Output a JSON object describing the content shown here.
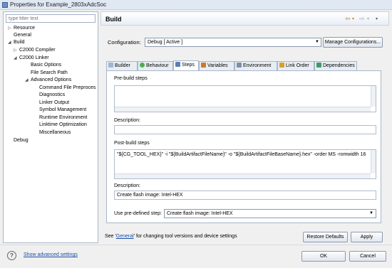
{
  "window": {
    "title": "Properties for Example_2803xAdcSoc"
  },
  "filter": {
    "placeholder": "type filter text"
  },
  "tree": {
    "resource": "Resource",
    "general": "General",
    "build": "Build",
    "compiler": "C2000 Compiler",
    "linker": "C2000 Linker",
    "basic_options": "Basic Options",
    "file_search_path": "File Search Path",
    "advanced_options": "Advanced Options",
    "cmd_file_preproc": "Command File Preproces",
    "diagnostics": "Diagnostics",
    "linker_output": "Linker Output",
    "symbol_mgmt": "Symbol Management",
    "runtime_env": "Runtime Environment",
    "linktime_opt": "Linktime Optimization",
    "misc": "Miscellaneous",
    "debug": "Debug"
  },
  "header": {
    "title": "Build",
    "back": "⇦",
    "forward": "⇨",
    "menu": "▾"
  },
  "config": {
    "label": "Configuration:",
    "value": "Debug  [ Active ]",
    "manage_button": "Manage Configurations..."
  },
  "tabs": [
    "Builder",
    "Behaviour",
    "Steps",
    "Variables",
    "Environment",
    "Link Order",
    "Dependencies"
  ],
  "steps": {
    "pre_label": "Pre-build steps",
    "pre_value": "",
    "pre_desc_label": "Description:",
    "pre_desc_value": "",
    "post_label": "Post-build steps",
    "post_value": "\"${CG_TOOL_HEX}\" -i \"${BuildArtifactFileName}\" -o \"${BuildArtifactFileBaseName}.hex\" -order MS -romwidth 16",
    "post_desc_label": "Description:",
    "post_desc_value": "Create flash image: Intel-HEX",
    "predef_label": "Use pre-defined step:",
    "predef_value": "Create flash image: Intel-HEX"
  },
  "bottom": {
    "note_prefix": "See '",
    "note_link": "General",
    "note_suffix": "' for changing tool versions and device settings",
    "restore_button": "Restore Defaults",
    "apply_button": "Apply"
  },
  "footer": {
    "help": "?",
    "advanced_link": "Show advanced settings",
    "ok_button": "OK",
    "cancel_button": "Cancel"
  }
}
